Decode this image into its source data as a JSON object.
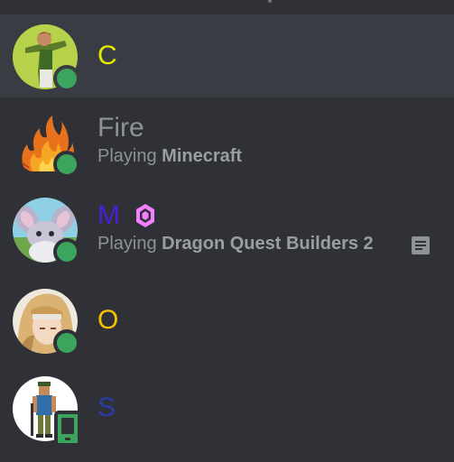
{
  "members": [
    {
      "name": "C",
      "name_color": "#e8e800",
      "status": "online",
      "activity_prefix": "",
      "activity_game": ""
    },
    {
      "name": "Fire",
      "name_color": "#8e9297",
      "status": "online",
      "activity_prefix": "Playing",
      "activity_game": "Minecraft"
    },
    {
      "name": "M",
      "name_color": "#4a1fd9",
      "status": "online",
      "badge": "nitro-boost-icon",
      "activity_prefix": "Playing",
      "activity_game": "Dragon Quest Builders 2",
      "activity_icon": "rich-presence-icon"
    },
    {
      "name": "O",
      "name_color": "#f5c400",
      "status": "online",
      "activity_prefix": "",
      "activity_game": ""
    },
    {
      "name": "S",
      "name_color": "#2b3ba8",
      "status": "mobile",
      "activity_prefix": "",
      "activity_game": ""
    }
  ]
}
